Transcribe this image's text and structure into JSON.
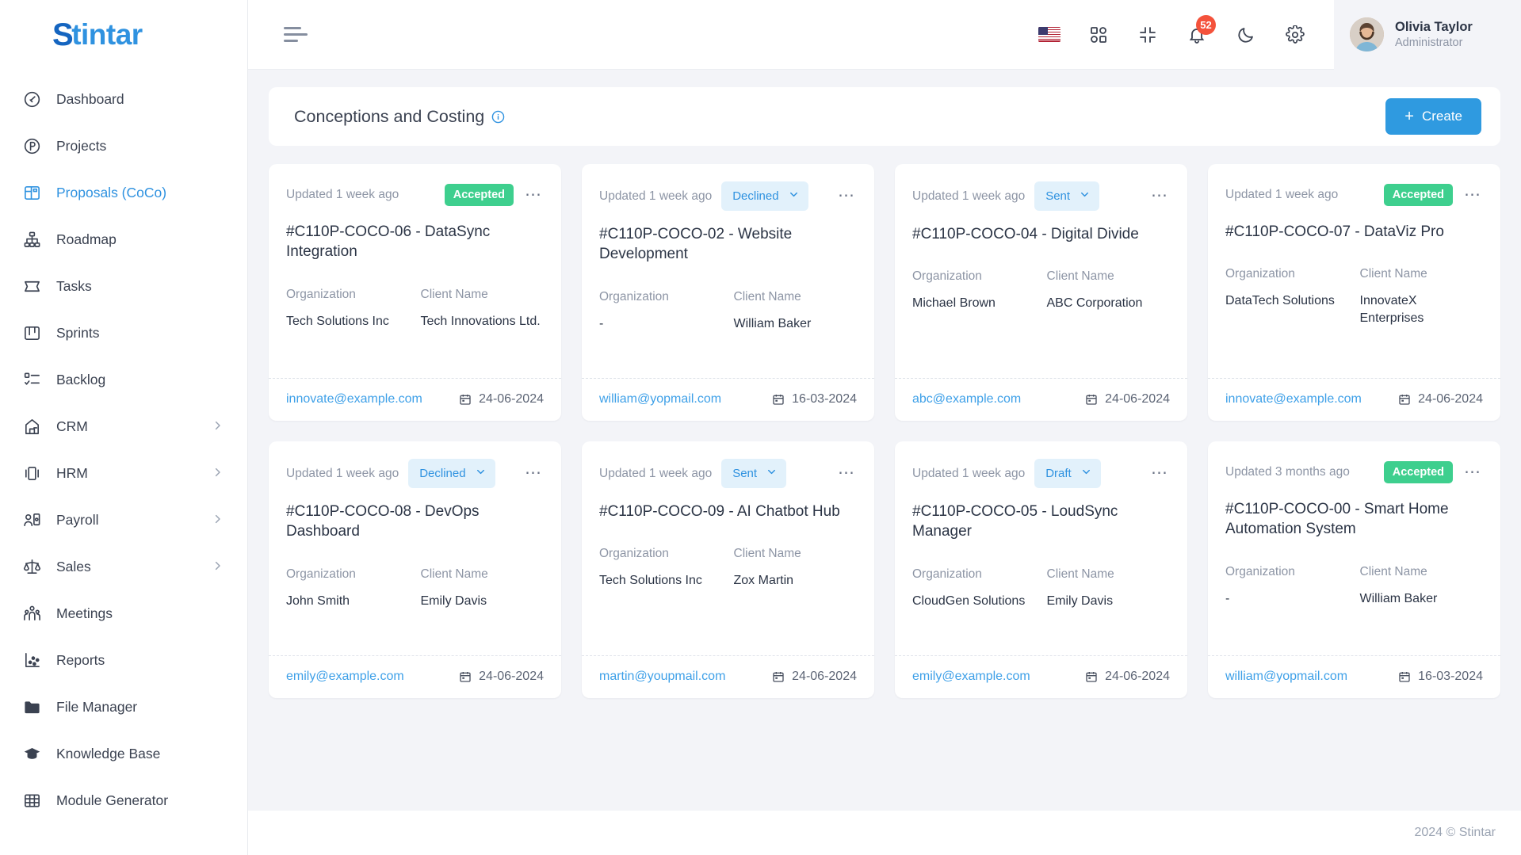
{
  "brand": {
    "prefix": "S",
    "rest": "tintar"
  },
  "sidebar": {
    "items": [
      {
        "label": "Dashboard",
        "icon": "gauge-icon",
        "active": false,
        "expandable": false
      },
      {
        "label": "Projects",
        "icon": "projects-icon",
        "active": false,
        "expandable": false
      },
      {
        "label": "Proposals (CoCo)",
        "icon": "proposals-icon",
        "active": true,
        "expandable": false
      },
      {
        "label": "Roadmap",
        "icon": "roadmap-icon",
        "active": false,
        "expandable": false
      },
      {
        "label": "Tasks",
        "icon": "tasks-icon",
        "active": false,
        "expandable": false
      },
      {
        "label": "Sprints",
        "icon": "sprints-icon",
        "active": false,
        "expandable": false
      },
      {
        "label": "Backlog",
        "icon": "backlog-icon",
        "active": false,
        "expandable": false
      },
      {
        "label": "CRM",
        "icon": "crm-icon",
        "active": false,
        "expandable": true
      },
      {
        "label": "HRM",
        "icon": "hrm-icon",
        "active": false,
        "expandable": true
      },
      {
        "label": "Payroll",
        "icon": "payroll-icon",
        "active": false,
        "expandable": true
      },
      {
        "label": "Sales",
        "icon": "sales-icon",
        "active": false,
        "expandable": true
      },
      {
        "label": "Meetings",
        "icon": "meetings-icon",
        "active": false,
        "expandable": false
      },
      {
        "label": "Reports",
        "icon": "reports-icon",
        "active": false,
        "expandable": false
      },
      {
        "label": "File Manager",
        "icon": "folder-icon",
        "active": false,
        "expandable": false
      },
      {
        "label": "Knowledge Base",
        "icon": "graduation-cap-icon",
        "active": false,
        "expandable": false
      },
      {
        "label": "Module Generator",
        "icon": "grid-table-icon",
        "active": false,
        "expandable": false
      }
    ]
  },
  "topbar": {
    "menu_toggle": "hamburger-icon",
    "language_flag": "us-flag-icon",
    "apps_icon": "apps-grid-icon",
    "fullscreen_icon": "collapse-screen-icon",
    "notification_icon": "bell-icon",
    "notification_count": "52",
    "theme_icon": "moon-icon",
    "settings_icon": "gear-icon",
    "user": {
      "name": "Olivia Taylor",
      "role": "Administrator"
    }
  },
  "page": {
    "title": "Conceptions and Costing",
    "info_icon": "info-circle-icon",
    "create_label": "Create",
    "create_plus": "+",
    "footer": "2024 © Stintar"
  },
  "labels": {
    "organization": "Organization",
    "client_name": "Client Name"
  },
  "colors": {
    "accent": "#2f9ae0",
    "accepted": "#3ecf8e",
    "pill_bg": "#e2f1fb",
    "pill_text": "#2f92e0",
    "badge_red": "#f4523b"
  },
  "cards": [
    {
      "updated": "Updated 1 week ago",
      "status": "Accepted",
      "status_type": "badge",
      "title": "#C110P-COCO-06 - DataSync Integration",
      "organization": "Tech Solutions Inc",
      "client": "Tech Innovations Ltd.",
      "email": "innovate@example.com",
      "date": "24-06-2024"
    },
    {
      "updated": "Updated 1 week ago",
      "status": "Declined",
      "status_type": "select",
      "title": "#C110P-COCO-02 - Website Development",
      "organization": "-",
      "client": "William Baker",
      "email": "william@yopmail.com",
      "date": "16-03-2024"
    },
    {
      "updated": "Updated 1 week ago",
      "status": "Sent",
      "status_type": "select",
      "title": "#C110P-COCO-04 - Digital Divide",
      "organization": "Michael Brown",
      "client": "ABC Corporation",
      "email": "abc@example.com",
      "date": "24-06-2024"
    },
    {
      "updated": "Updated 1 week ago",
      "status": "Accepted",
      "status_type": "badge",
      "title": "#C110P-COCO-07 - DataViz Pro",
      "organization": "DataTech Solutions",
      "client": "InnovateX Enterprises",
      "email": "innovate@example.com",
      "date": "24-06-2024"
    },
    {
      "updated": "Updated 1 week ago",
      "status": "Declined",
      "status_type": "select",
      "title": "#C110P-COCO-08 - DevOps Dashboard",
      "organization": "John Smith",
      "client": "Emily Davis",
      "email": "emily@example.com",
      "date": "24-06-2024"
    },
    {
      "updated": "Updated 1 week ago",
      "status": "Sent",
      "status_type": "select",
      "title": "#C110P-COCO-09 - AI Chatbot Hub",
      "organization": "Tech Solutions Inc",
      "client": "Zox Martin",
      "email": "martin@youpmail.com",
      "date": "24-06-2024"
    },
    {
      "updated": "Updated 1 week ago",
      "status": "Draft",
      "status_type": "select",
      "title": "#C110P-COCO-05 - LoudSync Manager",
      "organization": "CloudGen Solutions",
      "client": "Emily Davis",
      "email": "emily@example.com",
      "date": "24-06-2024"
    },
    {
      "updated": "Updated 3 months ago",
      "status": "Accepted",
      "status_type": "badge",
      "title": "#C110P-COCO-00 - Smart Home Automation System",
      "organization": "-",
      "client": "William Baker",
      "email": "william@yopmail.com",
      "date": "16-03-2024"
    }
  ]
}
